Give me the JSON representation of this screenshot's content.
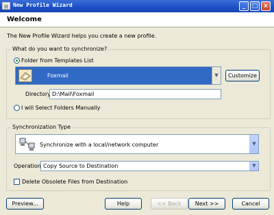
{
  "window": {
    "title": "New Profile Wizard"
  },
  "header": {
    "title": "Welcome"
  },
  "intro": "The New Profile Wizard helps you create a new profile.",
  "sync_group": {
    "legend": "What do you want to synchronize?",
    "option_templates": "Folder from Templates List",
    "template_selected": "Foxmail",
    "customize_label": "Customize",
    "directory_label": "Directory",
    "directory_value": "D:\\Mail\\Foxmail",
    "option_manual": "I will Select Folders Manually"
  },
  "type_group": {
    "legend": "Synchronization Type",
    "type_selected": "Synchronize with a local/network computer",
    "operation_label": "Operation",
    "operation_value": "Copy Source to Destination",
    "delete_label": "Delete Obsolete Files from Destination"
  },
  "buttons": {
    "preview": "Preview...",
    "help": "Help",
    "back": "<< Back",
    "next": "Next >>",
    "cancel": "Cancel"
  },
  "icons": [
    "app-icon",
    "minimize-icon",
    "maximize-icon",
    "close-icon",
    "folder-icon",
    "computer-network-icon",
    "chevron-down-icon"
  ]
}
